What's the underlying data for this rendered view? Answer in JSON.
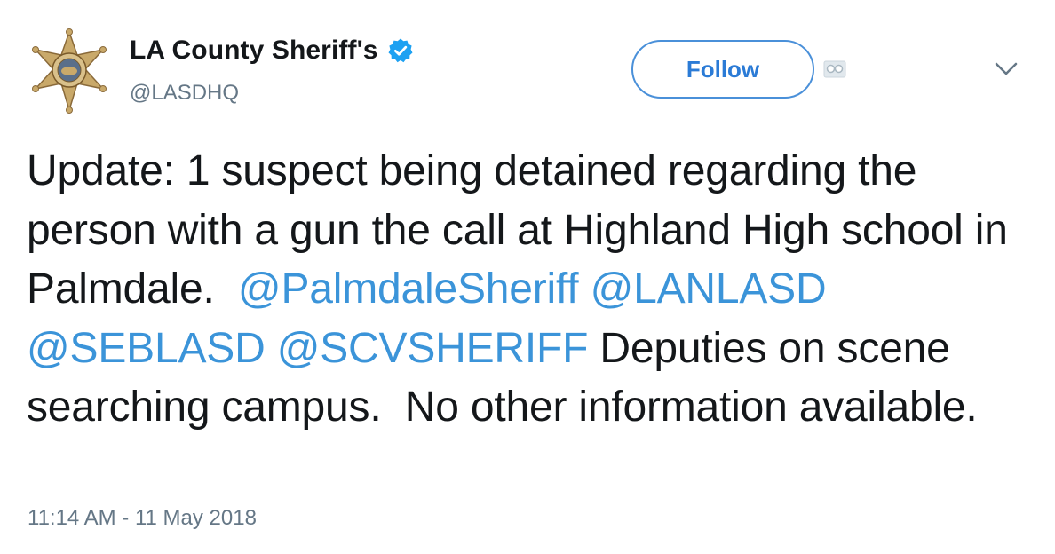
{
  "author": {
    "display_name": "LA County Sheriff's",
    "handle": "@LASDHQ",
    "verified_icon": "verified-badge-icon",
    "avatar_icon": "sheriff-star-badge-icon"
  },
  "actions": {
    "follow_label": "Follow",
    "caret_icon": "chevron-down-icon",
    "extra_icon": "card-icon"
  },
  "tweet": {
    "segments": [
      {
        "text": "Update: 1 suspect being detained regarding the person with a gun the call at Highland High school in Palmdale.  ",
        "type": "text"
      },
      {
        "text": "@PalmdaleSheriff",
        "type": "mention"
      },
      {
        "text": " ",
        "type": "text"
      },
      {
        "text": "@LANLASD",
        "type": "mention"
      },
      {
        "text": " ",
        "type": "text"
      },
      {
        "text": "@SEBLASD",
        "type": "mention"
      },
      {
        "text": " ",
        "type": "text"
      },
      {
        "text": "@SCVSHERIFF",
        "type": "mention"
      },
      {
        "text": " Deputies on scene searching campus.  No other information available.",
        "type": "text"
      }
    ],
    "timestamp": "11:14 AM - 11 May 2018"
  },
  "colors": {
    "mention": "#3b94d9",
    "follow_border": "#4a90d9",
    "secondary_text": "#657786",
    "verified": "#1da1f2"
  }
}
